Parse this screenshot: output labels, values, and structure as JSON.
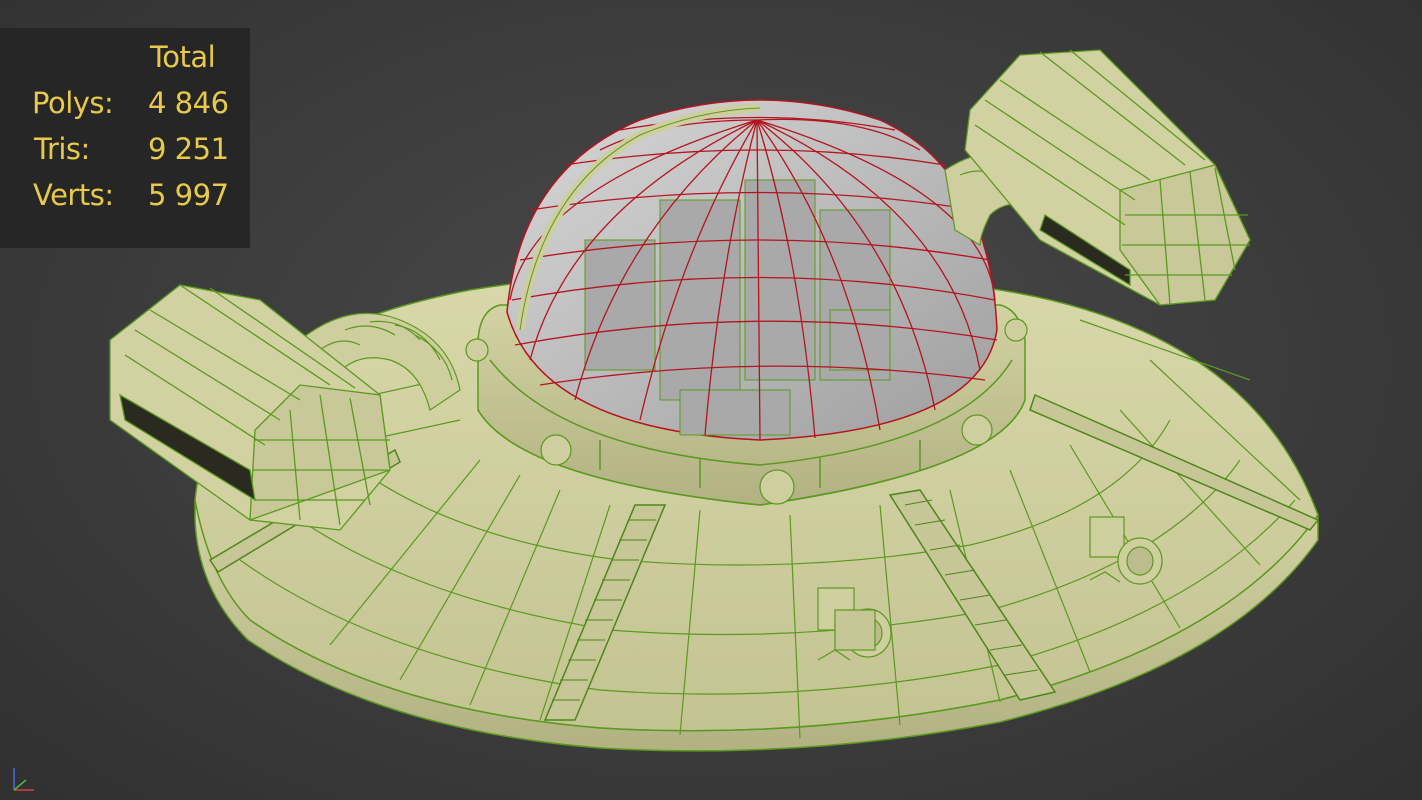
{
  "stats": {
    "header": "Total",
    "rows": [
      {
        "label": "Polys:",
        "value": "4 846"
      },
      {
        "label": "Tris:",
        "value": "9 251"
      },
      {
        "label": "Verts:",
        "value": "5 997"
      }
    ]
  },
  "colors": {
    "background": "#3c3c3c",
    "panel": "#262626",
    "stat_text": "#e8c94a",
    "mesh_fill": "#d6d5a5",
    "wire_green": "#5a9a1e",
    "wire_red": "#b4141e",
    "glass": "#c8c8c8"
  },
  "viewport": {
    "object": "flying-saucer-model",
    "shading": "smooth+wireframe",
    "axis_icon": "axis-tripod-icon"
  }
}
